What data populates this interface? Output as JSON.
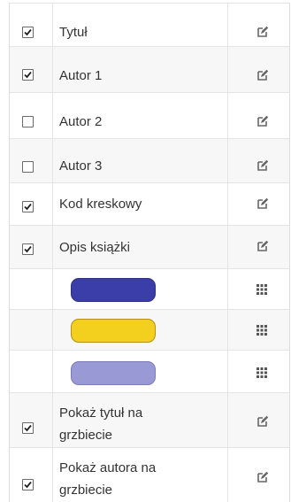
{
  "rows": [
    {
      "label": "Tytuł",
      "checked": true
    },
    {
      "label": "Autor 1",
      "checked": true
    },
    {
      "label": "Autor 2",
      "checked": false
    },
    {
      "label": "Autor 3",
      "checked": false
    },
    {
      "label": "Kod kreskowy",
      "checked": true
    },
    {
      "label": "Opis książki",
      "checked": true
    }
  ],
  "swatches": [
    {
      "color": "#3b3ea9",
      "border": "#2d307f"
    },
    {
      "color": "#f3cf1e",
      "border": "#b58f16"
    },
    {
      "color": "#9999d6",
      "border": "#7b7cb4"
    }
  ],
  "spine_rows": [
    {
      "line1": "Pokaż tytuł na",
      "line2": "grzbiecie",
      "checked": true
    },
    {
      "line1": "Pokaż autora na",
      "line2": "grzbiecie",
      "checked": true
    }
  ],
  "icons": {
    "edit": "edit-icon",
    "drag": "drag-handle-icon",
    "check": "check-icon"
  }
}
